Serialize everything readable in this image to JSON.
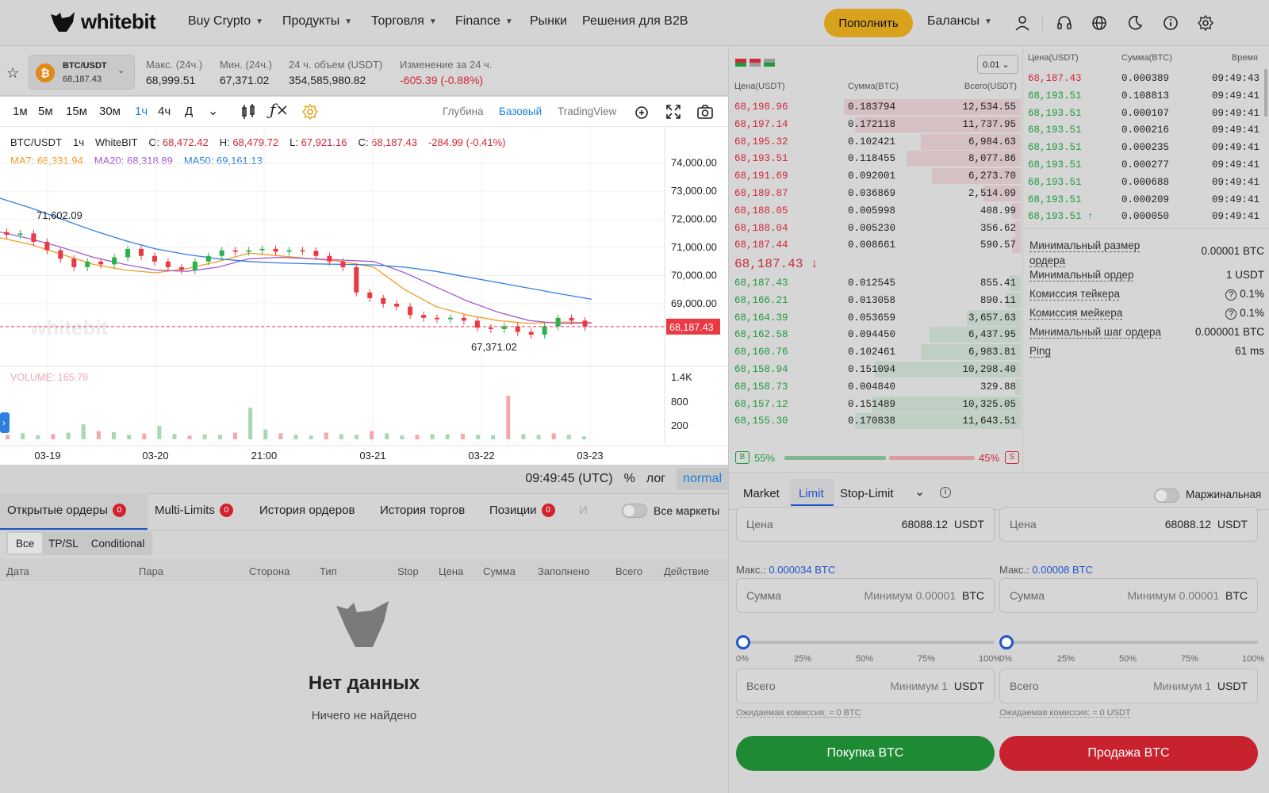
{
  "nav": {
    "logo": "whitebit",
    "items": [
      "Buy Crypto",
      "Продукты",
      "Торговля",
      "Finance",
      "Рынки",
      "Решения для B2B"
    ],
    "deposit": "Пополнить",
    "balances": "Балансы"
  },
  "market": {
    "pair": "BTC/USDT",
    "price": "68,187.43",
    "stats": [
      {
        "label": "Макс. (24ч.)",
        "value": "68,999.51"
      },
      {
        "label": "Мин. (24ч.)",
        "value": "67,371.02"
      },
      {
        "label": "24 ч. объем (USDT)",
        "value": "354,585,980.82"
      },
      {
        "label": "Изменение за 24 ч.",
        "value": "-605.39  (-0.88%)"
      }
    ]
  },
  "chart": {
    "timeframes": [
      "1м",
      "5м",
      "15м",
      "30м",
      "1ч",
      "4ч",
      "Д"
    ],
    "active_tf": "1ч",
    "views": [
      "Глубина",
      "Базовый",
      "TradingView"
    ],
    "active_view": "Базовый",
    "legend": {
      "pair": "BTC/USDT",
      "tf": "1ч",
      "source": "WhiteBIT",
      "o_label": "O:",
      "o": "68,472.42",
      "h_label": "H:",
      "h": "68,479.72",
      "l_label": "L:",
      "l": "67,921.16",
      "c_label": "C:",
      "c": "68,187.43",
      "change": "-284.99 (-0.41%)",
      "ma7": "MA7: 68,331.94",
      "ma20": "MA20: 68,318.89",
      "ma50": "MA50: 69,161.13"
    },
    "price_axis": [
      "74,000.00",
      "73,000.00",
      "72,000.00",
      "71,000.00",
      "70,000.00",
      "69,000.00"
    ],
    "last_price": "68,187.43",
    "high_marker": "71,602.09",
    "low_marker": "67,371.02",
    "volume_label": "VOLUME: 165.79",
    "volume_axis": [
      "1.4K",
      "800",
      "200"
    ],
    "date_axis": [
      "03-19",
      "03-20",
      "21:00",
      "03-21",
      "03-22",
      "03-23"
    ],
    "time_utc": "09:49:45 (UTC)",
    "opts": [
      "%",
      "лог",
      "normal"
    ]
  },
  "chart_data": {
    "type": "candlestick",
    "title": "BTC/USDT",
    "x": [
      "03-19",
      "03-20",
      "21:00",
      "03-21",
      "03-22",
      "03-23"
    ],
    "ylim": [
      67000,
      74300
    ],
    "ma_series": [
      {
        "name": "MA7",
        "color": "#f59a23",
        "y": [
          71350,
          71100,
          70750,
          70400,
          70200,
          70100,
          70250,
          70500,
          70800,
          70700,
          70600,
          70500,
          70300,
          69500,
          68900,
          68600,
          68400,
          68300,
          68350,
          68330
        ]
      },
      {
        "name": "MA20",
        "color": "#a45bd0",
        "y": [
          71550,
          71300,
          71000,
          70650,
          70400,
          70200,
          70150,
          70300,
          70600,
          70650,
          70600,
          70550,
          70500,
          70100,
          69600,
          69100,
          68700,
          68400,
          68300,
          68320
        ]
      },
      {
        "name": "MA50",
        "color": "#2f7fe0",
        "y": [
          72750,
          72400,
          72000,
          71600,
          71250,
          70950,
          70750,
          70600,
          70500,
          70450,
          70420,
          70400,
          70380,
          70300,
          70150,
          69950,
          69750,
          69550,
          69350,
          69160
        ]
      }
    ],
    "candles": [
      71450,
      71500,
      71200,
      70900,
      70600,
      70300,
      70500,
      70400,
      70650,
      70950,
      70700,
      70500,
      70300,
      70200,
      70500,
      70700,
      70900,
      70850,
      70900,
      70950,
      70850,
      70900,
      70880,
      70700,
      70500,
      70300,
      69400,
      69200,
      69000,
      68900,
      68600,
      68500,
      68450,
      68500,
      68400,
      68150,
      68100,
      68200,
      68000,
      67900,
      68200,
      68500,
      68400,
      68187
    ],
    "volumes": [
      60,
      80,
      55,
      70,
      90,
      200,
      110,
      95,
      60,
      75,
      180,
      70,
      50,
      65,
      60,
      90,
      420,
      130,
      80,
      60,
      50,
      90,
      70,
      60,
      110,
      80,
      50,
      60,
      70,
      65,
      75,
      60,
      55,
      580,
      70,
      60,
      80,
      60,
      40
    ]
  },
  "orderbook": {
    "precision": "0.01",
    "headers": [
      "Цена(USDT)",
      "Сумма(BTC)",
      "Всего(USDT)"
    ],
    "asks": [
      [
        "68,198.96",
        "0.183794",
        "12,534.55"
      ],
      [
        "68,197.14",
        "0.172118",
        "11,737.95"
      ],
      [
        "68,195.32",
        "0.102421",
        "6,984.63"
      ],
      [
        "68,193.51",
        "0.118455",
        "8,077.86"
      ],
      [
        "68,191.69",
        "0.092001",
        "6,273.70"
      ],
      [
        "68,189.87",
        "0.036869",
        "2,514.09"
      ],
      [
        "68,188.05",
        "0.005998",
        "408.99"
      ],
      [
        "68,188.04",
        "0.005230",
        "356.62"
      ],
      [
        "68,187.44",
        "0.008661",
        "590.57"
      ]
    ],
    "last": "68,187.43 ↓",
    "bids": [
      [
        "68,187.43",
        "0.012545",
        "855.41"
      ],
      [
        "68,166.21",
        "0.013058",
        "890.11"
      ],
      [
        "68,164.39",
        "0.053659",
        "3,657.63"
      ],
      [
        "68,162.58",
        "0.094450",
        "6,437.95"
      ],
      [
        "68,160.76",
        "0.102461",
        "6,983.81"
      ],
      [
        "68,158.94",
        "0.151094",
        "10,298.40"
      ],
      [
        "68,158.73",
        "0.004840",
        "329.88"
      ],
      [
        "68,157.12",
        "0.151489",
        "10,325.05"
      ],
      [
        "68,155.30",
        "0.170838",
        "11,643.51"
      ]
    ],
    "ask_depth": [
      0.62,
      0.58,
      0.35,
      0.4,
      0.31,
      0.13,
      0.03,
      0.02,
      0.03
    ],
    "bid_depth": [
      0.04,
      0.05,
      0.19,
      0.32,
      0.35,
      0.51,
      0.02,
      0.52,
      0.58
    ],
    "buy_label": "B",
    "buy_pct": "55%",
    "sell_label": "S",
    "sell_pct": "45%",
    "buy_share": 0.55
  },
  "trades": {
    "headers": [
      "Цена(USDT)",
      "Сумма(BTC)",
      "Время"
    ],
    "rows": [
      [
        "68,187.43",
        "0.000389",
        "09:49:43",
        "sell"
      ],
      [
        "68,193.51",
        "0.108813",
        "09:49:41",
        "buy"
      ],
      [
        "68,193.51",
        "0.000107",
        "09:49:41",
        "buy"
      ],
      [
        "68,193.51",
        "0.000216",
        "09:49:41",
        "buy"
      ],
      [
        "68,193.51",
        "0.000235",
        "09:49:41",
        "buy"
      ],
      [
        "68,193.51",
        "0.000277",
        "09:49:41",
        "buy"
      ],
      [
        "68,193.51",
        "0.000688",
        "09:49:41",
        "buy"
      ],
      [
        "68,193.51",
        "0.000209",
        "09:49:41",
        "buy"
      ],
      [
        "68,193.51 ↑",
        "0.000050",
        "09:49:41",
        "buy"
      ]
    ]
  },
  "info": [
    [
      "Минимальный размер ордера",
      "0.00001 BTC"
    ],
    [
      "Минимальный ордер",
      "1 USDT"
    ],
    [
      "Комиссия тейкера",
      "0.1%"
    ],
    [
      "Комиссия мейкера",
      "0.1%"
    ],
    [
      "Минимальный шаг ордера",
      "0.000001 BTC"
    ],
    [
      "Ping",
      "61 ms"
    ]
  ],
  "orders": {
    "tabs": [
      "Открытые ордеры",
      "Multi-Limits",
      "История ордеров",
      "История торгов",
      "Позиции"
    ],
    "badge": "0",
    "truncated_tab": "И",
    "all_markets": "Все маркеты",
    "filters": [
      "Все",
      "TP/SL",
      "Conditional"
    ],
    "columns": [
      "Дата",
      "Пара",
      "Сторона",
      "Тип",
      "Stop",
      "Цена",
      "Сумма",
      "Заполнено",
      "Всего",
      "Действие"
    ],
    "empty_title": "Нет данных",
    "empty_sub": "Ничего не найдено"
  },
  "form": {
    "tabs": [
      "Market",
      "Limit",
      "Stop-Limit"
    ],
    "active_tab": "Limit",
    "margin": "Маржинальная",
    "price_label": "Цена",
    "price_value": "68088.12",
    "quote": "USDT",
    "base": "BTC",
    "max_label": "Макс.:",
    "buy_max": "0.000034 BTC",
    "sell_max": "0.00008 BTC",
    "amount_label": "Сумма",
    "amount_ph": "Минимум 0.00001",
    "total_label": "Всего",
    "total_ph": "Минимум 1",
    "pcts": [
      "0%",
      "25%",
      "50%",
      "75%",
      "100%"
    ],
    "buy_fee": "Ожидаемая комиссия: ≈ 0 BTC",
    "sell_fee": "Ожидаемая комиссия: ≈ 0 USDT",
    "buy_btn": "Покупка BTC",
    "sell_btn": "Продажа BTC"
  },
  "colors": {
    "accent": "#d8a21d",
    "buy": "#1f9b3c",
    "sell": "#d0283a",
    "link": "#1e55c9"
  }
}
